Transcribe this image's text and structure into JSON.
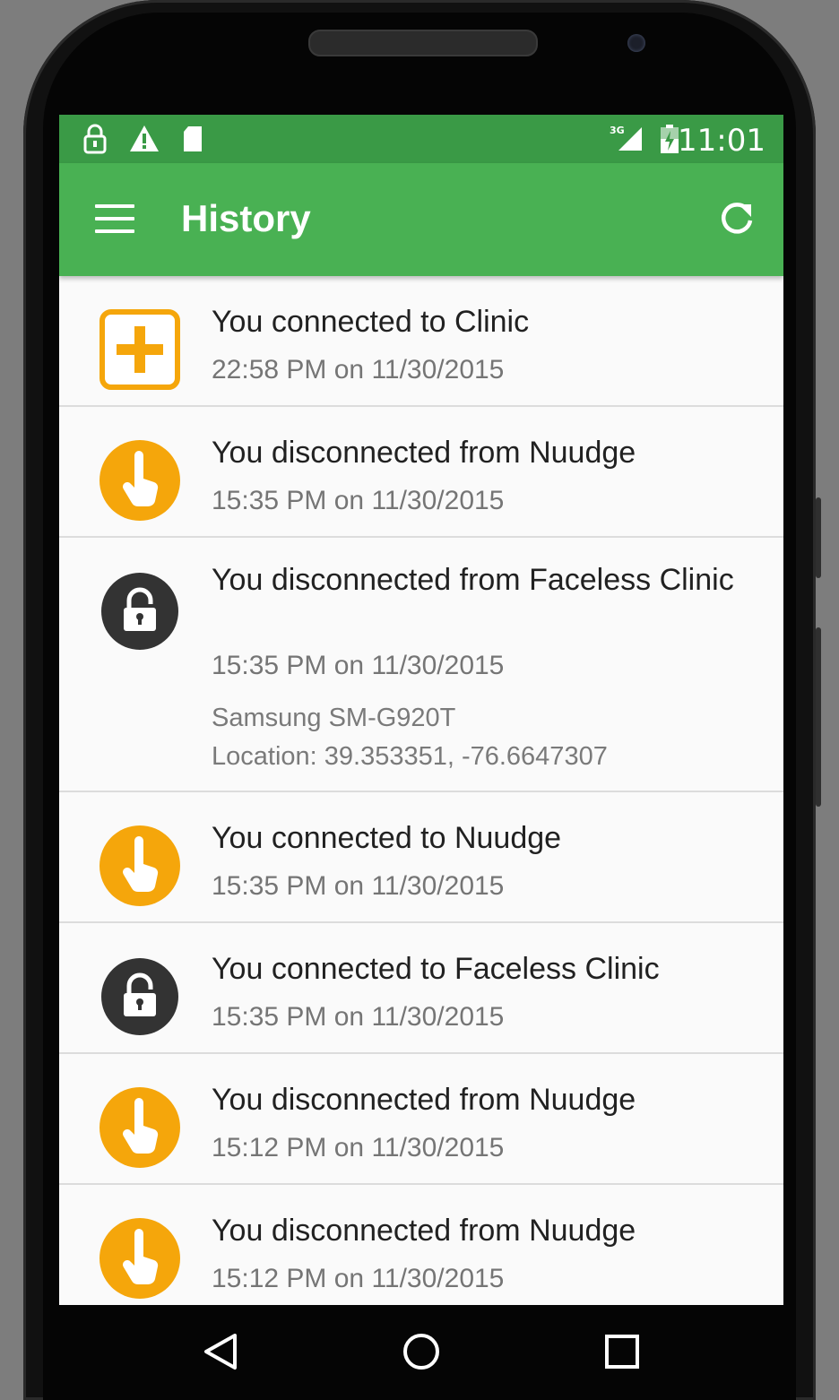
{
  "status_bar": {
    "time": "11:01",
    "icons": [
      "lock-icon",
      "warning-icon",
      "sd-card-icon",
      "signal-3g-icon",
      "battery-charging-icon"
    ],
    "network_label": "3G"
  },
  "app_bar": {
    "title": "History",
    "menu_icon": "hamburger-menu-icon",
    "action_icon": "refresh-icon",
    "color": "#49b153"
  },
  "history": [
    {
      "icon": "medical-plus-icon",
      "title": "You connected to Clinic",
      "time": "22:58 PM on 11/30/2015"
    },
    {
      "icon": "finger-icon",
      "title": "You disconnected from Nuudge",
      "time": "15:35 PM on 11/30/2015"
    },
    {
      "icon": "unlock-icon",
      "title": "You disconnected from Faceless Clinic",
      "time": "15:35 PM on 11/30/2015",
      "device": "Samsung SM-G920T",
      "location": "Location: 39.353351, -76.6647307"
    },
    {
      "icon": "finger-icon",
      "title": "You connected to Nuudge",
      "time": "15:35 PM on 11/30/2015"
    },
    {
      "icon": "unlock-icon",
      "title": "You connected to Faceless Clinic",
      "time": "15:35 PM on 11/30/2015"
    },
    {
      "icon": "finger-icon",
      "title": "You disconnected from Nuudge",
      "time": "15:12 PM on 11/30/2015"
    },
    {
      "icon": "finger-icon",
      "title": "You disconnected from Nuudge",
      "time": "15:12 PM on 11/30/2015"
    }
  ],
  "nav_bar": {
    "buttons": [
      "back-icon",
      "home-icon",
      "recents-icon"
    ]
  },
  "colors": {
    "status_bar": "#3a9a46",
    "accent_orange": "#f5a60b",
    "lock_dark": "#333333"
  }
}
